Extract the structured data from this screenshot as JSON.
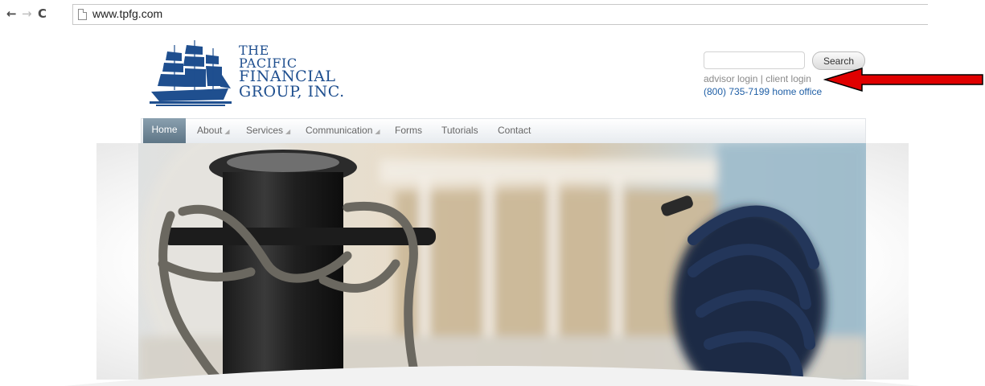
{
  "browser": {
    "nav": {
      "back": "←",
      "forward": "→",
      "reload": "C"
    },
    "url": "www.tpfg.com"
  },
  "site": {
    "logo": {
      "line1": "THE",
      "line2": "PACIFIC",
      "line3": "FINANCIAL",
      "line4": "GROUP, INC.",
      "icon": "sailing-ship-icon",
      "color": "#1f4f8f"
    },
    "search": {
      "button_label": "Search",
      "value": ""
    },
    "login": {
      "advisor": "advisor login",
      "separator": "|",
      "client": "client login"
    },
    "phone": "(800) 735-7199 home office",
    "nav": {
      "home": "Home",
      "items": [
        "About",
        "Services",
        "Communication",
        "Forms",
        "Tutorials",
        "Contact"
      ],
      "dropdown_marker": "◢"
    },
    "hero": {
      "description_icon": "dock-bollard-photo"
    },
    "annotation": {
      "icon": "red-arrow-icon",
      "color": "#e00000"
    }
  }
}
